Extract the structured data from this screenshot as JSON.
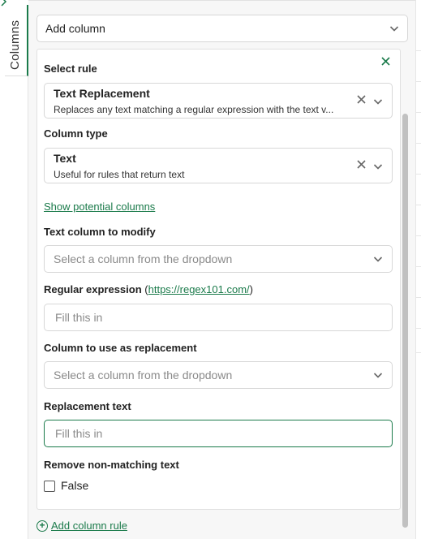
{
  "rail": {
    "tab_label": "Columns",
    "expand_icon": "chevron-right-icon"
  },
  "toolbar": {
    "add_column_label": "Add column"
  },
  "rule": {
    "section_label": "Select rule",
    "selected_title": "Text Replacement",
    "selected_description": "Replaces any text matching a regular expression with the text v...",
    "close_icon": "close-icon",
    "clear_icon": "clear-icon"
  },
  "column_type": {
    "section_label": "Column type",
    "selected_title": "Text",
    "selected_description": "Useful for rules that return text"
  },
  "show_columns_link": "Show potential columns",
  "text_column": {
    "label": "Text column to modify",
    "placeholder": "Select a column from the dropdown"
  },
  "regex": {
    "label": "Regular expression",
    "paren_open": "(",
    "link": "https://regex101.com/",
    "paren_close": ")",
    "placeholder": "Fill this in"
  },
  "replacement_column": {
    "label": "Column to use as replacement",
    "placeholder": "Select a column from the dropdown"
  },
  "replacement_text": {
    "label": "Replacement text",
    "placeholder": "Fill this in"
  },
  "remove_non_matching": {
    "label": "Remove non-matching text",
    "checkbox_label": "False",
    "checked": false
  },
  "add_rule_label": "Add column rule",
  "colors": {
    "accent": "#1a7a4a",
    "panel_bg": "#f7f7f7",
    "border": "#d7d7d7"
  }
}
